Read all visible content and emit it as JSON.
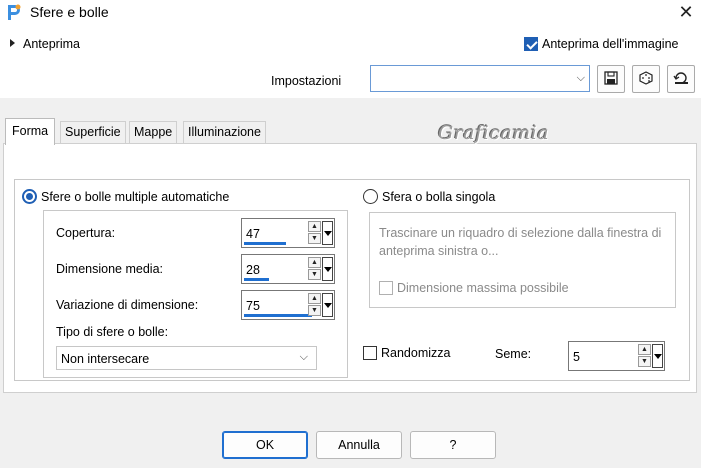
{
  "window": {
    "title": "Sfere e bolle",
    "icon": "paintshop-icon",
    "close_glyph": "✕"
  },
  "top": {
    "preview_label": "Anteprima",
    "image_preview_label": "Anteprima dell'immagine",
    "image_preview_checked": true,
    "settings_label": "Impostazioni",
    "settings_value": "",
    "toolbar_icons": [
      "save-icon",
      "dice-icon",
      "reset-icon"
    ]
  },
  "tabs": [
    {
      "label": "Forma",
      "active": true
    },
    {
      "label": "Superficie",
      "active": false
    },
    {
      "label": "Mappe",
      "active": false
    },
    {
      "label": "Illuminazione",
      "active": false
    }
  ],
  "watermark": "Graficamia",
  "multiple": {
    "label": "Sfere o bolle multiple automatiche",
    "selected": true,
    "coverage_label": "Copertura:",
    "coverage_value": "47",
    "coverage_fraction": 0.47,
    "mean_size_label": "Dimensione media:",
    "mean_size_value": "28",
    "mean_size_fraction": 0.28,
    "size_variation_label": "Variazione di dimensione:",
    "size_variation_value": "75",
    "size_variation_fraction": 0.75,
    "type_label": "Tipo di sfere o bolle:",
    "type_value": "Non intersecare"
  },
  "single": {
    "label": "Sfera o bolla singola",
    "selected": false,
    "hint": "Trascinare un riquadro di selezione dalla finestra di anteprima sinistra o...",
    "max_size_label": "Dimensione massima possibile",
    "max_size_checked": false
  },
  "randomize": {
    "label": "Randomizza",
    "checked": false
  },
  "seed": {
    "label": "Seme:",
    "value": "5"
  },
  "buttons": {
    "ok": "OK",
    "cancel": "Annulla",
    "help": "?"
  },
  "colors": {
    "accent": "#1f5fb4",
    "bar": "#1f6fd0",
    "window_bg": "#f0f0f0"
  }
}
